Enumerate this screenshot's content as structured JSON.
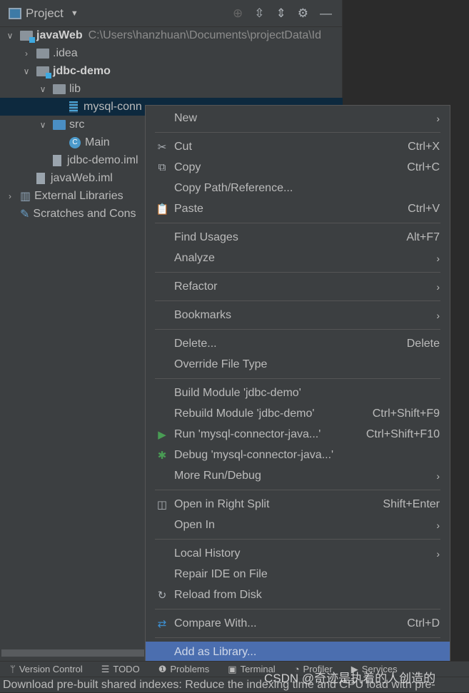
{
  "panel": {
    "title": "Project",
    "icons": [
      "locate-icon",
      "expand-all-icon",
      "collapse-all-icon",
      "gear-icon",
      "minimize-icon"
    ]
  },
  "tree": [
    {
      "label": "javaWeb",
      "path": "C:\\Users\\hanzhuan\\Documents\\projectData\\Id",
      "type": "module",
      "expanded": true
    },
    {
      "label": ".idea",
      "type": "folder",
      "expanded": false
    },
    {
      "label": "jdbc-demo",
      "type": "module",
      "expanded": true
    },
    {
      "label": "lib",
      "type": "folder",
      "expanded": true
    },
    {
      "label": "mysql-conn",
      "type": "jar",
      "selected": true
    },
    {
      "label": "src",
      "type": "source-folder",
      "expanded": true
    },
    {
      "label": "Main",
      "type": "class"
    },
    {
      "label": "jdbc-demo.iml",
      "type": "file"
    },
    {
      "label": "javaWeb.iml",
      "type": "file"
    },
    {
      "label": "External Libraries",
      "type": "libraries",
      "expanded": false
    },
    {
      "label": "Scratches and Cons",
      "type": "scratches"
    }
  ],
  "menu": [
    {
      "label": "New",
      "submenu": true
    },
    {
      "sep": true
    },
    {
      "label": "Cut",
      "shortcut": "Ctrl+X",
      "icon": "scissors-icon"
    },
    {
      "label": "Copy",
      "shortcut": "Ctrl+C",
      "icon": "copy-icon"
    },
    {
      "label": "Copy Path/Reference..."
    },
    {
      "label": "Paste",
      "shortcut": "Ctrl+V",
      "icon": "paste-icon"
    },
    {
      "sep": true
    },
    {
      "label": "Find Usages",
      "shortcut": "Alt+F7"
    },
    {
      "label": "Analyze",
      "submenu": true
    },
    {
      "sep": true
    },
    {
      "label": "Refactor",
      "submenu": true
    },
    {
      "sep": true
    },
    {
      "label": "Bookmarks",
      "submenu": true
    },
    {
      "sep": true
    },
    {
      "label": "Delete...",
      "shortcut": "Delete"
    },
    {
      "label": "Override File Type"
    },
    {
      "sep": true
    },
    {
      "label": "Build Module 'jdbc-demo'"
    },
    {
      "label": "Rebuild Module 'jdbc-demo'",
      "shortcut": "Ctrl+Shift+F9"
    },
    {
      "label": "Run 'mysql-connector-java...'",
      "shortcut": "Ctrl+Shift+F10",
      "icon": "run-icon"
    },
    {
      "label": "Debug 'mysql-connector-java...'",
      "icon": "debug-icon"
    },
    {
      "label": "More Run/Debug",
      "submenu": true
    },
    {
      "sep": true
    },
    {
      "label": "Open in Right Split",
      "shortcut": "Shift+Enter",
      "icon": "split-icon"
    },
    {
      "label": "Open In",
      "submenu": true
    },
    {
      "sep": true
    },
    {
      "label": "Local History",
      "submenu": true
    },
    {
      "label": "Repair IDE on File"
    },
    {
      "label": "Reload from Disk",
      "icon": "reload-icon"
    },
    {
      "sep": true
    },
    {
      "label": "Compare With...",
      "shortcut": "Ctrl+D",
      "icon": "compare-icon"
    },
    {
      "sep": true
    },
    {
      "label": "Add as Library...",
      "highlighted": true
    }
  ],
  "toolwindows": [
    "Version Control",
    "TODO",
    "Problems",
    "Terminal",
    "Profiler",
    "Services"
  ],
  "status": "Download pre-built shared indexes: Reduce the indexing time and CPU load with pre-",
  "watermark": "CSDN @奇迹是执着的人创造的",
  "colors": {
    "highlight": "#4b6eaf",
    "selection": "#0d293e",
    "run": "#499c54"
  }
}
